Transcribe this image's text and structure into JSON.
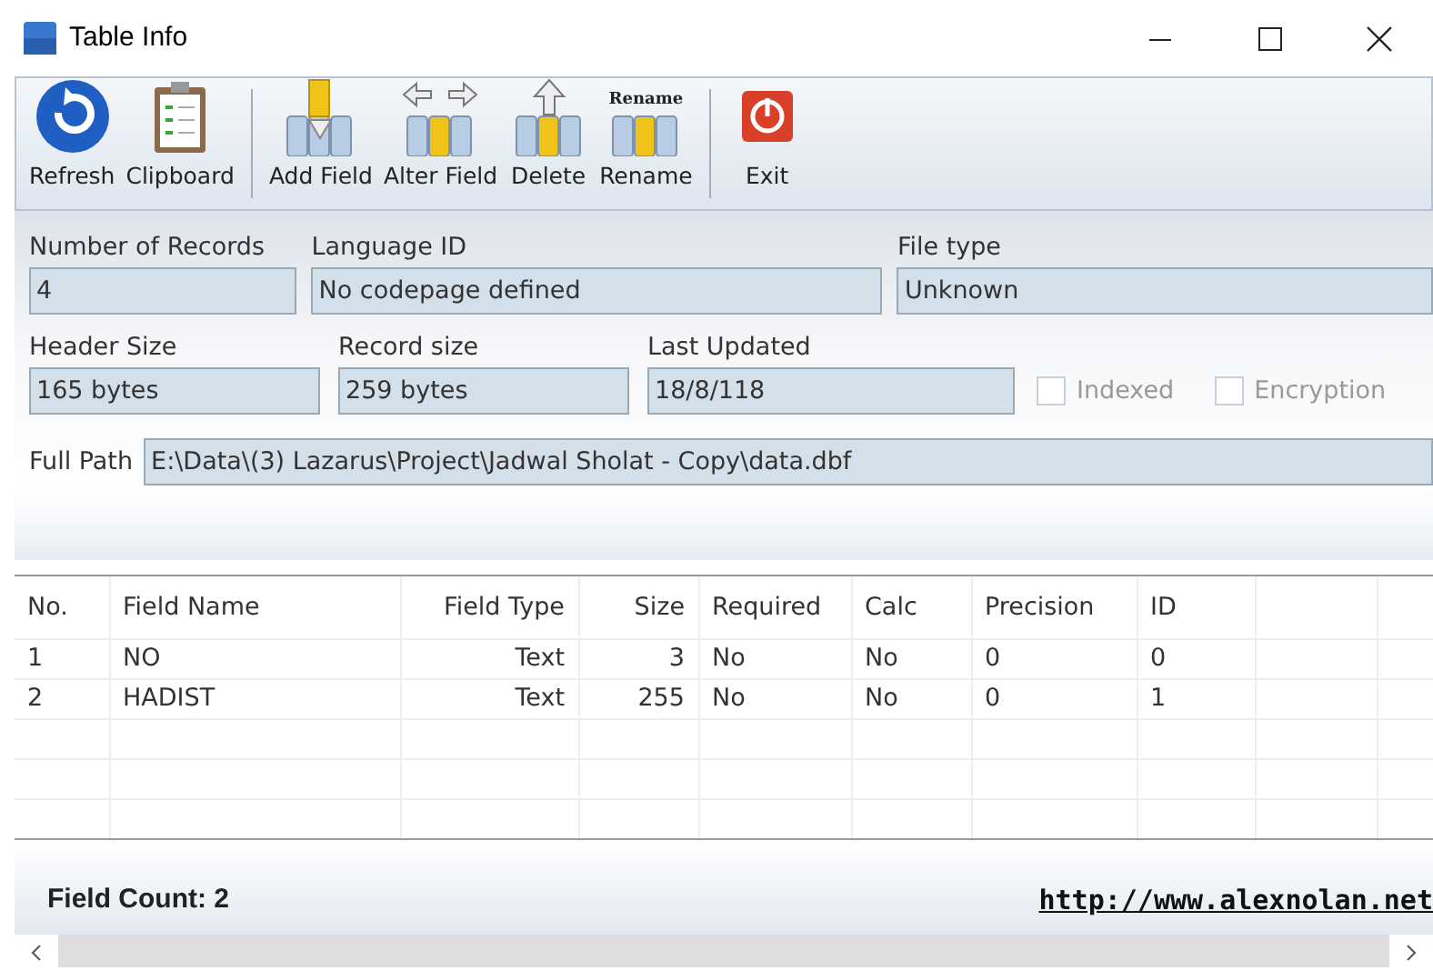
{
  "window": {
    "title": "Table Info"
  },
  "toolbar": [
    [
      {
        "label": "Refresh",
        "kind": "refresh"
      },
      {
        "label": "Clipboard",
        "kind": "clipboard"
      }
    ],
    [
      {
        "label": "Add Field",
        "kind": "add"
      },
      {
        "label": "Alter Field",
        "kind": "alter"
      },
      {
        "label": "Delete",
        "kind": "delete"
      },
      {
        "label": "Rename",
        "kind": "rename",
        "icon_text": "Rename"
      }
    ],
    [
      {
        "label": "Exit",
        "kind": "exit"
      }
    ]
  ],
  "info": {
    "row_1": [
      {
        "label": "Number of Records",
        "value": "4"
      },
      {
        "label": "Language ID",
        "value": "No codepage defined"
      },
      {
        "label": "File type",
        "value": "Unknown"
      }
    ],
    "row_2": [
      {
        "label": "Header Size",
        "value": "165 bytes"
      },
      {
        "label": "Record size",
        "value": "259 bytes"
      },
      {
        "label": "Last Updated",
        "value": "18/8/118"
      }
    ],
    "checkboxes": [
      {
        "label": "Indexed",
        "checked": false,
        "disabled": true
      },
      {
        "label": "Encryption",
        "checked": false,
        "disabled": true
      }
    ],
    "full_path": {
      "label": "Full Path",
      "value": "E:\\Data\\(3) Lazarus\\Project\\Jadwal Sholat - Copy\\data.dbf"
    }
  },
  "table": {
    "columns": [
      "No.",
      "Field Name",
      "Field Type",
      "Size",
      "Required",
      "Calc",
      "Precision",
      "ID"
    ],
    "rows": [
      [
        "1",
        "NO",
        "Text",
        "3",
        "No",
        "No",
        "0",
        "0"
      ],
      [
        "2",
        "HADIST",
        "Text",
        "255",
        "No",
        "No",
        "0",
        "1"
      ]
    ]
  },
  "status_bar": {
    "field_count": "Field Count: 2",
    "link": "http://www.alexnolan.net"
  }
}
